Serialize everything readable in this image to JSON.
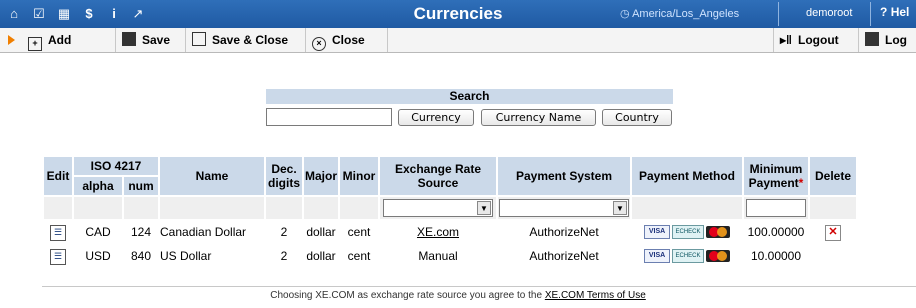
{
  "titlebar": {
    "title": "Currencies",
    "timezone": "America/Los_Angeles",
    "user": "demoroot",
    "help": "Hel"
  },
  "toolbar": {
    "add": "Add",
    "save": "Save",
    "save_close": "Save & Close",
    "close": "Close",
    "logout": "Logout",
    "log": "Log"
  },
  "search": {
    "heading": "Search",
    "input_value": "",
    "btn_currency": "Currency",
    "btn_currency_name": "Currency Name",
    "btn_country": "Country"
  },
  "table": {
    "headers": {
      "edit": "Edit",
      "iso": "ISO 4217",
      "alpha": "alpha",
      "num": "num",
      "name": "Name",
      "dec": "Dec. digits",
      "major": "Major",
      "minor": "Minor",
      "xrate": "Exchange Rate Source",
      "payment_system": "Payment System",
      "payment_method": "Payment Method",
      "minimum": "Minimum Payment",
      "required_mark": "*",
      "delete": "Delete"
    },
    "rows": [
      {
        "alpha": "CAD",
        "num": "124",
        "name": "Canadian Dollar",
        "dec": "2",
        "major": "dollar",
        "minor": "cent",
        "xrate": "XE.com",
        "payment_system": "AuthorizeNet",
        "minimum": "100.00000",
        "deletable": true
      },
      {
        "alpha": "USD",
        "num": "840",
        "name": "US Dollar",
        "dec": "2",
        "major": "dollar",
        "minor": "cent",
        "xrate": "Manual",
        "payment_system": "AuthorizeNet",
        "minimum": "10.00000",
        "deletable": false
      }
    ],
    "payment_icons": {
      "visa": "VISA",
      "echeck": "ECHECK"
    }
  },
  "footer": {
    "text": "Choosing XE.COM as exchange rate source you agree to the",
    "link": "XE.COM Terms of Use"
  }
}
